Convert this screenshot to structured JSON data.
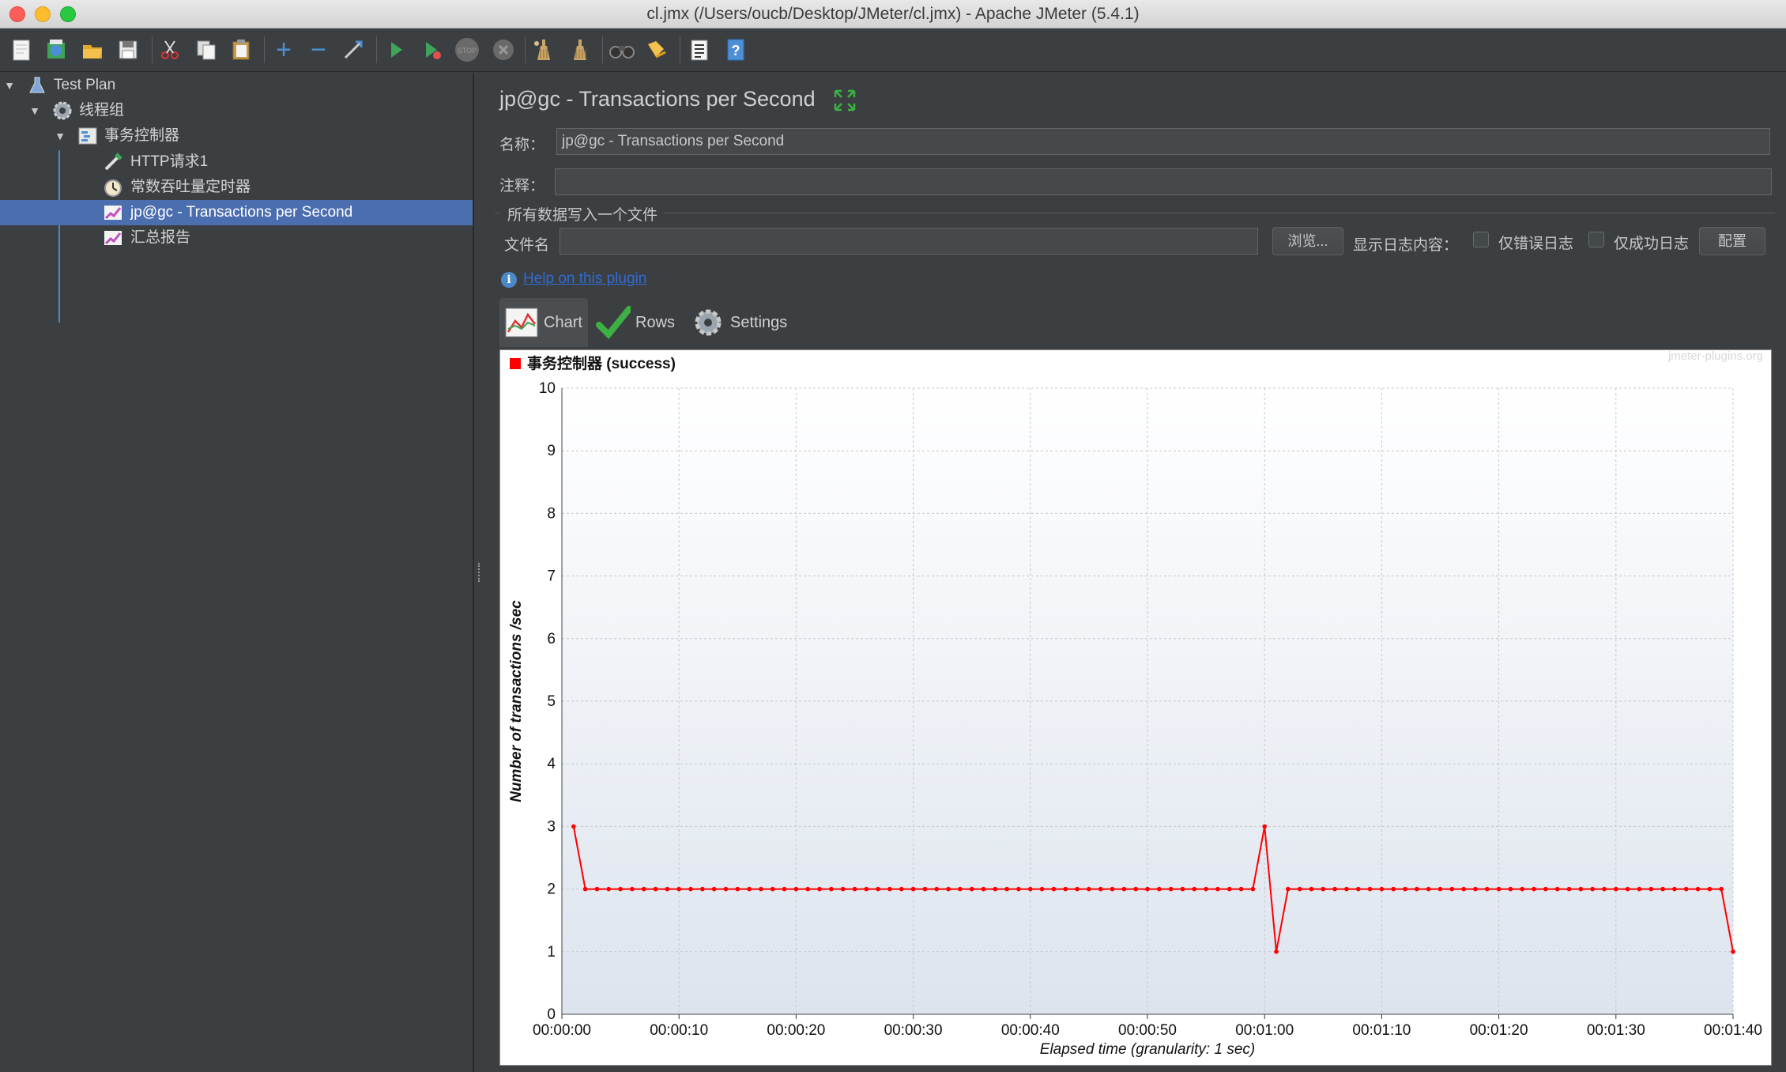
{
  "window": {
    "title": "cl.jmx (/Users/oucb/Desktop/JMeter/cl.jmx) - Apache JMeter (5.4.1)"
  },
  "toolbar": {
    "icons": [
      "new-icon",
      "templates-icon",
      "open-icon",
      "save-icon",
      "cut-icon",
      "copy-icon",
      "paste-icon",
      "expand-all-icon",
      "collapse-all-icon",
      "toggle-icon",
      "start-icon",
      "start-no-pauses-icon",
      "stop-icon",
      "shutdown-icon",
      "clear-icon",
      "clear-all-icon",
      "search-icon",
      "reset-search-icon",
      "function-helper-icon",
      "help-icon"
    ]
  },
  "tree": {
    "items": [
      {
        "label": "Test Plan",
        "icon": "flask-icon"
      },
      {
        "label": "线程组",
        "icon": "gear-icon"
      },
      {
        "label": "事务控制器",
        "icon": "controller-icon"
      },
      {
        "label": "HTTP请求1",
        "icon": "pipette-icon"
      },
      {
        "label": "常数吞吐量定时器",
        "icon": "timer-icon"
      },
      {
        "label": "jp@gc - Transactions per Second",
        "icon": "graph-icon",
        "selected": true
      },
      {
        "label": "汇总报告",
        "icon": "graph-icon"
      }
    ]
  },
  "main": {
    "title": "jp@gc - Transactions per Second",
    "name_label": "名称：",
    "name_value": "jp@gc - Transactions per Second",
    "comment_label": "注释：",
    "comment_value": "",
    "file_group_label": "所有数据写入一个文件",
    "file_label": "文件名",
    "file_value": "",
    "browse_button": "浏览...",
    "log_label": "显示日志内容：",
    "errors_only_label": "仅错误日志",
    "errors_only_checked": false,
    "success_only_label": "仅成功日志",
    "success_only_checked": false,
    "configure_button": "配置",
    "help_link": "Help on this plugin",
    "tabs": [
      {
        "label": "Chart",
        "active": true
      },
      {
        "label": "Rows",
        "active": false
      },
      {
        "label": "Settings",
        "active": false
      }
    ]
  },
  "chart_data": {
    "type": "line",
    "watermark": "jmeter-plugins.org",
    "xlabel": "Elapsed time (granularity: 1 sec)",
    "ylabel": "Number of transactions /sec",
    "ylim": [
      0,
      10
    ],
    "xlim_seconds": [
      0,
      100
    ],
    "x_ticks": [
      "00:00:00",
      "00:00:10",
      "00:00:20",
      "00:00:30",
      "00:00:40",
      "00:00:50",
      "00:01:00",
      "00:01:10",
      "00:01:20",
      "00:01:30",
      "00:01:40"
    ],
    "y_ticks": [
      "0",
      "1",
      "2",
      "3",
      "4",
      "5",
      "6",
      "7",
      "8",
      "9",
      "10"
    ],
    "grid": true,
    "legend_position": "top-left",
    "series": [
      {
        "name": "事务控制器 (success)",
        "color": "#ff0000",
        "x_seconds_start": 1,
        "values": [
          3,
          2,
          2,
          2,
          2,
          2,
          2,
          2,
          2,
          2,
          2,
          2,
          2,
          2,
          2,
          2,
          2,
          2,
          2,
          2,
          2,
          2,
          2,
          2,
          2,
          2,
          2,
          2,
          2,
          2,
          2,
          2,
          2,
          2,
          2,
          2,
          2,
          2,
          2,
          2,
          2,
          2,
          2,
          2,
          2,
          2,
          2,
          2,
          2,
          2,
          2,
          2,
          2,
          2,
          2,
          2,
          2,
          2,
          2,
          3,
          1,
          2,
          2,
          2,
          2,
          2,
          2,
          2,
          2,
          2,
          2,
          2,
          2,
          2,
          2,
          2,
          2,
          2,
          2,
          2,
          2,
          2,
          2,
          2,
          2,
          2,
          2,
          2,
          2,
          2,
          2,
          2,
          2,
          2,
          2,
          2,
          2,
          2,
          2,
          1
        ]
      }
    ]
  }
}
